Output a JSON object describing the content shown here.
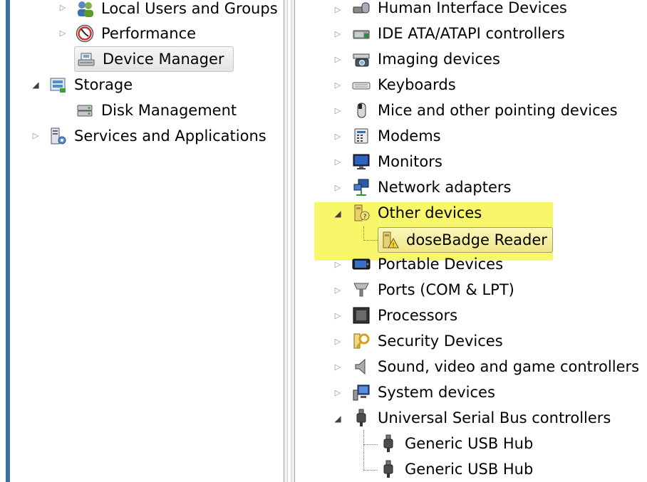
{
  "left_tree": {
    "items": [
      {
        "label": "Local Users and Groups",
        "icon": "users-icon",
        "expander": "collapsed"
      },
      {
        "label": "Performance",
        "icon": "performance-gauge-icon",
        "expander": "collapsed"
      },
      {
        "label": "Device Manager",
        "icon": "device-manager-icon",
        "selected": true
      },
      {
        "label": "Storage",
        "icon": "storage-icon",
        "expander": "expanded"
      },
      {
        "label": "Disk Management",
        "icon": "disk-management-icon"
      },
      {
        "label": "Services and Applications",
        "icon": "services-icon",
        "expander": "collapsed"
      }
    ]
  },
  "device_tree": {
    "highlight_color": "#f8f76a",
    "items": [
      {
        "label": "Human Interface Devices",
        "icon": "hid-icon",
        "expander": "collapsed"
      },
      {
        "label": "IDE ATA/ATAPI controllers",
        "icon": "ide-controller-icon",
        "expander": "collapsed"
      },
      {
        "label": "Imaging devices",
        "icon": "imaging-device-icon",
        "expander": "collapsed"
      },
      {
        "label": "Keyboards",
        "icon": "keyboard-icon",
        "expander": "collapsed"
      },
      {
        "label": "Mice and other pointing devices",
        "icon": "mouse-icon",
        "expander": "collapsed"
      },
      {
        "label": "Modems",
        "icon": "modem-icon",
        "expander": "collapsed"
      },
      {
        "label": "Monitors",
        "icon": "monitor-icon",
        "expander": "collapsed"
      },
      {
        "label": "Network adapters",
        "icon": "network-adapter-icon",
        "expander": "collapsed"
      },
      {
        "label": "Other devices",
        "icon": "unknown-device-icon",
        "expander": "expanded"
      },
      {
        "label": "doseBadge Reader",
        "icon": "warning-device-icon",
        "selected": true
      },
      {
        "label": "Portable Devices",
        "icon": "portable-device-icon",
        "expander": "collapsed"
      },
      {
        "label": "Ports (COM & LPT)",
        "icon": "port-icon",
        "expander": "collapsed"
      },
      {
        "label": "Processors",
        "icon": "processor-icon",
        "expander": "collapsed"
      },
      {
        "label": "Security Devices",
        "icon": "security-key-icon",
        "expander": "collapsed"
      },
      {
        "label": "Sound, video and game controllers",
        "icon": "speaker-icon",
        "expander": "collapsed"
      },
      {
        "label": "System devices",
        "icon": "system-device-icon",
        "expander": "collapsed"
      },
      {
        "label": "Universal Serial Bus controllers",
        "icon": "usb-icon",
        "expander": "expanded"
      },
      {
        "label": "Generic USB Hub",
        "icon": "usb-icon"
      },
      {
        "label": "Generic USB Hub",
        "icon": "usb-icon"
      }
    ]
  }
}
